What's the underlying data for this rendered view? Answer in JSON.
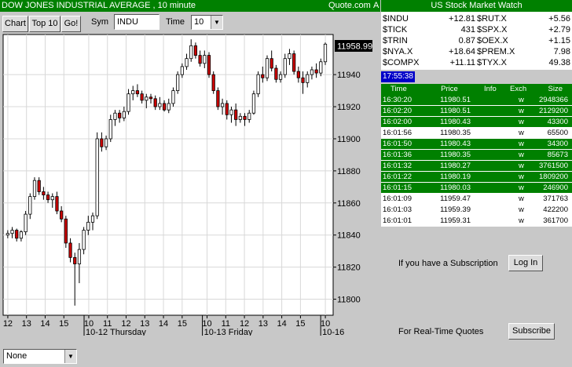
{
  "header": {
    "title": "DOW JONES INDUSTRIAL AVERAGE   , 10 minute",
    "source": "Quote.com",
    "extra": "A"
  },
  "toolbar": {
    "chart_button": "Chart",
    "top10_button": "Top 10",
    "go_button": "Go!",
    "sym_label": "Sym",
    "sym_value": "INDU",
    "time_label": "Time",
    "time_value": "10"
  },
  "bottom": {
    "study_select": "None"
  },
  "chart_data": {
    "type": "candlestick",
    "last_price_label": "11958.99",
    "ylim": [
      11790,
      11965
    ],
    "y_ticks": [
      11800,
      11820,
      11840,
      11860,
      11880,
      11900,
      11920,
      11940
    ],
    "x_ticks": [
      "12",
      "13",
      "14",
      "15",
      "10",
      "11",
      "12",
      "13",
      "14",
      "15",
      "10",
      "11",
      "12",
      "13",
      "14",
      "15",
      "10"
    ],
    "x_tick_index": [
      1,
      7,
      13,
      19,
      27,
      33,
      39,
      45,
      51,
      57,
      65,
      71,
      77,
      83,
      89,
      95,
      103
    ],
    "date_labels": [
      {
        "label": "10-12 Thursday",
        "index": 26
      },
      {
        "label": "10-13 Friday",
        "index": 64
      },
      {
        "label": "10-16",
        "index": 102
      }
    ],
    "colors": {
      "up": "#ffffff",
      "down": "#cc0000",
      "wick": "#000000"
    },
    "candles": [
      [
        11840,
        11843,
        11838,
        11841
      ],
      [
        11841,
        11845,
        11838,
        11843
      ],
      [
        11843,
        11844,
        11836,
        11838
      ],
      [
        11838,
        11843,
        11836,
        11842
      ],
      [
        11842,
        11855,
        11840,
        11853
      ],
      [
        11853,
        11866,
        11850,
        11864
      ],
      [
        11864,
        11876,
        11862,
        11874
      ],
      [
        11874,
        11876,
        11865,
        11867
      ],
      [
        11867,
        11870,
        11862,
        11865
      ],
      [
        11865,
        11867,
        11860,
        11862
      ],
      [
        11862,
        11866,
        11857,
        11864
      ],
      [
        11864,
        11867,
        11853,
        11855
      ],
      [
        11855,
        11858,
        11848,
        11850
      ],
      [
        11850,
        11852,
        11832,
        11835
      ],
      [
        11835,
        11838,
        11823,
        11826
      ],
      [
        11826,
        11829,
        11796,
        11822
      ],
      [
        11822,
        11835,
        11810,
        11831
      ],
      [
        11831,
        11845,
        11828,
        11843
      ],
      [
        11843,
        11852,
        11840,
        11848
      ],
      [
        11848,
        11854,
        11843,
        11852
      ],
      [
        11852,
        11904,
        11850,
        11900
      ],
      [
        11900,
        11904,
        11892,
        11895
      ],
      [
        11895,
        11902,
        11893,
        11900
      ],
      [
        11900,
        11915,
        11898,
        11912
      ],
      [
        11912,
        11918,
        11908,
        11916
      ],
      [
        11916,
        11918,
        11910,
        11913
      ],
      [
        11913,
        11920,
        11911,
        11917
      ],
      [
        11917,
        11931,
        11915,
        11928
      ],
      [
        11928,
        11933,
        11924,
        11930
      ],
      [
        11930,
        11934,
        11926,
        11928
      ],
      [
        11928,
        11930,
        11922,
        11924
      ],
      [
        11924,
        11928,
        11919,
        11926
      ],
      [
        11926,
        11928,
        11922,
        11925
      ],
      [
        11925,
        11927,
        11918,
        11920
      ],
      [
        11920,
        11926,
        11918,
        11922
      ],
      [
        11922,
        11924,
        11917,
        11918
      ],
      [
        11918,
        11925,
        11916,
        11922
      ],
      [
        11922,
        11932,
        11920,
        11930
      ],
      [
        11930,
        11942,
        11928,
        11940
      ],
      [
        11940,
        11947,
        11938,
        11945
      ],
      [
        11945,
        11953,
        11943,
        11950
      ],
      [
        11950,
        11962,
        11948,
        11958
      ],
      [
        11958,
        11960,
        11950,
        11952
      ],
      [
        11952,
        11955,
        11945,
        11947
      ],
      [
        11947,
        11955,
        11944,
        11952
      ],
      [
        11952,
        11954,
        11938,
        11940
      ],
      [
        11940,
        11942,
        11928,
        11930
      ],
      [
        11930,
        11932,
        11918,
        11920
      ],
      [
        11920,
        11925,
        11915,
        11922
      ],
      [
        11922,
        11924,
        11912,
        11915
      ],
      [
        11915,
        11920,
        11910,
        11918
      ],
      [
        11918,
        11922,
        11908,
        11912
      ],
      [
        11912,
        11916,
        11910,
        11914
      ],
      [
        11914,
        11916,
        11908,
        11912
      ],
      [
        11912,
        11918,
        11910,
        11916
      ],
      [
        11916,
        11930,
        11915,
        11928
      ],
      [
        11928,
        11942,
        11926,
        11940
      ],
      [
        11940,
        11945,
        11935,
        11938
      ],
      [
        11938,
        11952,
        11936,
        11950
      ],
      [
        11950,
        11955,
        11942,
        11944
      ],
      [
        11944,
        11946,
        11935,
        11937
      ],
      [
        11937,
        11942,
        11935,
        11940
      ],
      [
        11940,
        11953,
        11938,
        11950
      ],
      [
        11950,
        11956,
        11946,
        11953
      ],
      [
        11953,
        11955,
        11940,
        11942
      ],
      [
        11942,
        11945,
        11935,
        11938
      ],
      [
        11938,
        11942,
        11928,
        11935
      ],
      [
        11935,
        11942,
        11932,
        11940
      ],
      [
        11940,
        11945,
        11937,
        11943
      ],
      [
        11943,
        11947,
        11938,
        11941
      ],
      [
        11941,
        11950,
        11939,
        11948
      ],
      [
        11948,
        11960,
        11946,
        11959
      ]
    ]
  },
  "watch": {
    "title": "US Stock Market Watch",
    "rows": [
      {
        "sym1": "$INDU",
        "val1": "+12.81",
        "sym2": "$RUT.X",
        "val2": "+5.56"
      },
      {
        "sym1": "$TICK",
        "val1": "431",
        "sym2": "$SPX.X",
        "val2": "+2.79"
      },
      {
        "sym1": "$TRIN",
        "val1": "0.87",
        "sym2": "$OEX.X",
        "val2": "+1.15"
      },
      {
        "sym1": "$NYA.X",
        "val1": "+18.64",
        "sym2": "$PREM.X",
        "val2": "7.98"
      },
      {
        "sym1": "$COMPX",
        "val1": "+11.11",
        "sym2": "$TYX.X",
        "val2": "49.38"
      }
    ]
  },
  "ticker": {
    "clock": "17:55:38",
    "headers": {
      "time": "Time",
      "price": "Price",
      "info": "Info",
      "exch": "Exch",
      "size": "Size"
    },
    "rows": [
      {
        "time": "16:30:20",
        "price": "11980.51",
        "exch": "w",
        "size": "2948366",
        "style": "g"
      },
      {
        "time": "16:02:20",
        "price": "11980.51",
        "exch": "w",
        "size": "2129200",
        "style": "g"
      },
      {
        "time": "16:02:00",
        "price": "11980.43",
        "exch": "w",
        "size": "43300",
        "style": "g"
      },
      {
        "time": "16:01:56",
        "price": "11980.35",
        "exch": "w",
        "size": "65500",
        "style": "w"
      },
      {
        "time": "16:01:50",
        "price": "11980.43",
        "exch": "w",
        "size": "34300",
        "style": "g"
      },
      {
        "time": "16:01:36",
        "price": "11980.35",
        "exch": "w",
        "size": "85673",
        "style": "g"
      },
      {
        "time": "16:01:32",
        "price": "11980.27",
        "exch": "w",
        "size": "3761500",
        "style": "g"
      },
      {
        "time": "16:01:22",
        "price": "11980.19",
        "exch": "w",
        "size": "1809200",
        "style": "g"
      },
      {
        "time": "16:01:15",
        "price": "11980.03",
        "exch": "w",
        "size": "246900",
        "style": "g"
      },
      {
        "time": "16:01:09",
        "price": "11959.47",
        "exch": "w",
        "size": "371763",
        "style": "w"
      },
      {
        "time": "16:01:03",
        "price": "11959.39",
        "exch": "w",
        "size": "422200",
        "style": "w"
      },
      {
        "time": "16:01:01",
        "price": "11959.31",
        "exch": "w",
        "size": "361700",
        "style": "w"
      }
    ]
  },
  "subscription": {
    "message": "If you have a Subscription",
    "login_button": "Log In",
    "realtime_message": "For Real-Time Quotes",
    "subscribe_button": "Subscribe"
  }
}
